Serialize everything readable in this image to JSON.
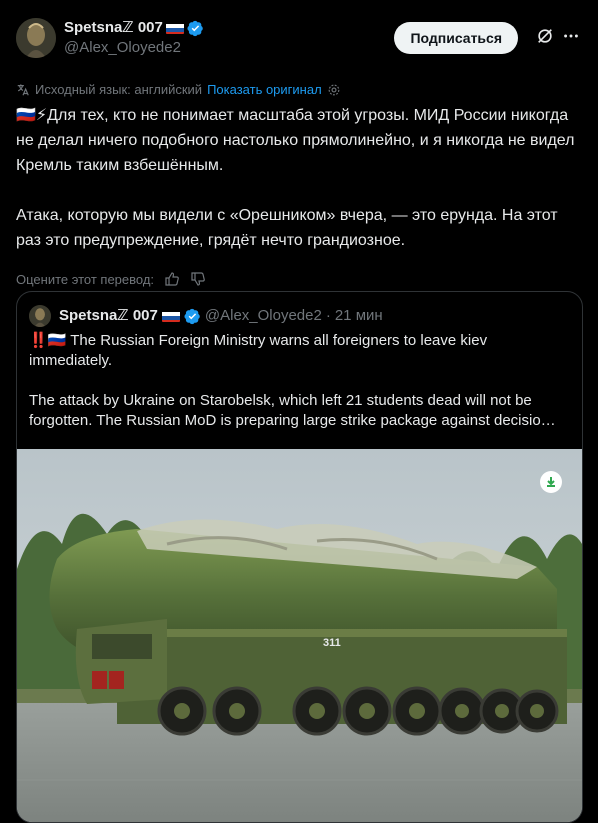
{
  "author": {
    "display_name": "Spetsnaℤ 007",
    "handle": "@Alex_Oloyede2",
    "flag": "ru-flag",
    "verified_icon": "verified-badge-icon"
  },
  "header": {
    "follow_label": "Подписаться",
    "grok_icon": "grok-icon",
    "more_icon": "more-icon"
  },
  "translation": {
    "source_text": "Исходный язык: английский",
    "show_original": "Показать оригинал"
  },
  "post": {
    "paragraph1": "🇷🇺⚡Для тех, кто не понимает масштаба этой угрозы. МИД России никогда не делал ничего подобного настолько прямолинейно, и я никогда не видел Кремль таким взбешённым.",
    "paragraph2": "Атака, которую мы видели с «Орешником» вчера, — это ерунда. На этот раз это предупреждение, грядёт нечто грандиозное."
  },
  "rating": {
    "label": "Оцените этот перевод:"
  },
  "quote": {
    "display_name": "Spetsnaℤ 007",
    "handle": "@Alex_Oloyede2",
    "separator": "·",
    "time": "21 мин",
    "paragraph1": "‼️🇷🇺 The Russian Foreign Ministry warns all foreigners to leave kiev immediately.",
    "paragraph2": "The attack by Ukraine on Starobelsk, which left 21 students dead will not be forgotten. The Russian MoD is preparing large strike package against decisio…",
    "vehicle_number": "311"
  },
  "colors": {
    "background": "#000000",
    "text": "#e7e9ea",
    "muted": "#71767b",
    "link": "#1d9bf0",
    "border": "#2f3336"
  }
}
